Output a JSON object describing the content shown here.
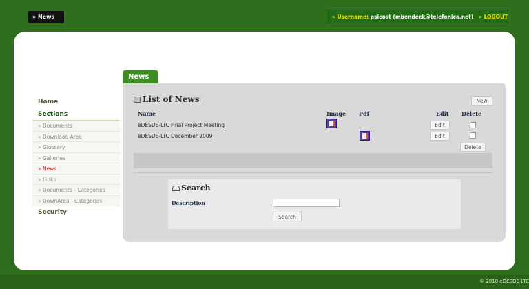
{
  "topbar": {
    "section_label": "» News",
    "username_prefix": "» Username:",
    "username": "psicost (mbendeck@telefonica.net)",
    "logout": "» LOGOUT"
  },
  "sidebar": {
    "home": "Home",
    "sections": "Sections",
    "items": [
      {
        "label": "» Documents",
        "active": false
      },
      {
        "label": "» Download Area",
        "active": false
      },
      {
        "label": "» Glossary",
        "active": false
      },
      {
        "label": "» Galleries",
        "active": false
      },
      {
        "label": "» News",
        "active": true
      },
      {
        "label": "» Links",
        "active": false
      },
      {
        "label": "» Documents - Categories",
        "active": false
      },
      {
        "label": "» DownArea - Categories",
        "active": false
      }
    ],
    "security": "Security"
  },
  "main": {
    "tab": "News",
    "list_title": "List of News",
    "new_button": "New",
    "columns": {
      "name": "Name",
      "image": "Image",
      "pdf": "Pdf",
      "edit": "Edit",
      "delete": "Delete"
    },
    "rows": [
      {
        "name": "eDESDE-LTC Final Project Meeting",
        "has_image": true,
        "has_pdf": false,
        "edit": "Edit",
        "delete_checked": false
      },
      {
        "name": "eDESDE-LTC December 2009",
        "has_image": false,
        "has_pdf": true,
        "edit": "Edit",
        "delete_checked": false
      }
    ],
    "delete_button": "Delete",
    "search": {
      "title": "Search",
      "description_label": "Description",
      "description_value": "",
      "button": "Search"
    }
  },
  "footer": {
    "copyright": "© 2010 eDESDE-LTC"
  },
  "colors": {
    "background": "#2e6e1d",
    "accent_green": "#3e8b25",
    "active_link": "#d41515",
    "username_yellow": "#f2e600"
  }
}
